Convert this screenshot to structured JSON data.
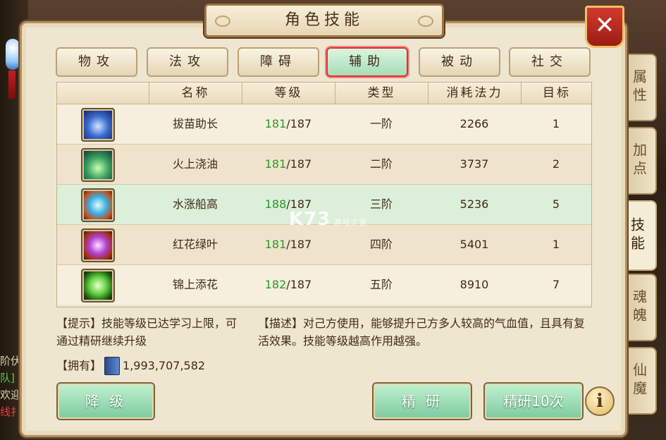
{
  "window": {
    "title": "角色技能",
    "close_label": "✕"
  },
  "side_tabs": [
    {
      "label": "属性",
      "active": false
    },
    {
      "label": "加点",
      "active": false
    },
    {
      "label": "技能",
      "active": true
    },
    {
      "label": "魂魄",
      "active": false
    },
    {
      "label": "仙魔",
      "active": false
    }
  ],
  "category_tabs": [
    {
      "label": "物攻",
      "active": false
    },
    {
      "label": "法攻",
      "active": false
    },
    {
      "label": "障碍",
      "active": false
    },
    {
      "label": "辅助",
      "active": true
    },
    {
      "label": "被动",
      "active": false
    },
    {
      "label": "社交",
      "active": false
    }
  ],
  "table": {
    "headers": [
      "",
      "名称",
      "等级",
      "类型",
      "消耗法力",
      "目标"
    ],
    "rows": [
      {
        "icon": "wing-magic-icon",
        "name": "拔苗助长",
        "level_current": "181",
        "level_max": "/187",
        "type": "一阶",
        "mana": "2266",
        "target": "1"
      },
      {
        "icon": "sprout-magic-icon",
        "name": "火上浇油",
        "level_current": "181",
        "level_max": "/187",
        "type": "二阶",
        "mana": "3737",
        "target": "2"
      },
      {
        "icon": "water-lotus-icon",
        "name": "水涨船高",
        "level_current": "188",
        "level_max": "/187",
        "type": "三阶",
        "mana": "5236",
        "target": "5"
      },
      {
        "icon": "purple-flower-icon",
        "name": "红花绿叶",
        "level_current": "181",
        "level_max": "/187",
        "type": "四阶",
        "mana": "5401",
        "target": "1"
      },
      {
        "icon": "green-blossom-icon",
        "name": "锦上添花",
        "level_current": "182",
        "level_max": "/187",
        "type": "五阶",
        "mana": "8910",
        "target": "7"
      }
    ],
    "selected_row": 2
  },
  "watermark": {
    "text": "K73",
    "sub": "游戏之家"
  },
  "hint": "【提示】技能等级已达学习上限，可通过精研继续升级",
  "description": "【描述】对己方使用，能够提升己方多人较高的气血值，且具有复活效果。技能等级越高作用越强。",
  "owned": {
    "label": "【拥有】",
    "amount": "1,993,707,582"
  },
  "buttons": {
    "downgrade": "降 级",
    "refine": "精 研",
    "refine10": "精研10次",
    "info": "i"
  },
  "background_chat": [
    "阶伏",
    "队]",
    "欢迎",
    "线扌"
  ],
  "colors": {
    "level_current": "#2a9a2a",
    "active_tab_border": "#e03030",
    "button_green": "#7fcca0",
    "close_red": "#d23a2e"
  }
}
